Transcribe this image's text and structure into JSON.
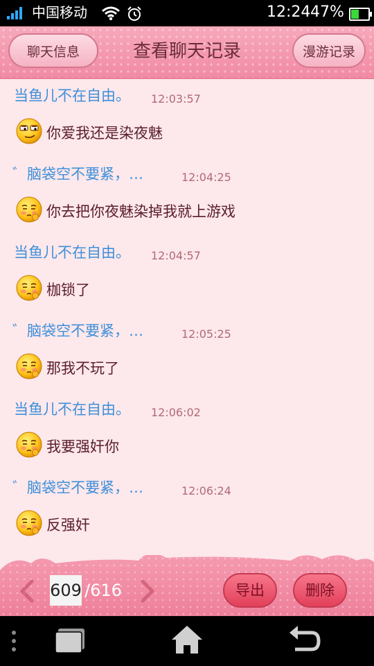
{
  "status_bar": {
    "carrier": "中国移动",
    "time": "12:24",
    "battery": "47%",
    "battery_level": 0.47
  },
  "header": {
    "left_button": "聊天信息",
    "title": "查看聊天记录",
    "right_button": "漫游记录"
  },
  "messages": [
    {
      "sender": "当鱼儿不在自由。",
      "time": "12:03:57",
      "text": "你爱我还是染夜魅",
      "emoji": "smug-face"
    },
    {
      "sender": "゛脑袋空不要紧，…",
      "time": "12:04:25",
      "text": "你去把你夜魅染掉我就上游戏",
      "emoji": "shy-face"
    },
    {
      "sender": "当鱼儿不在自由。",
      "time": "12:04:57",
      "text": "枷锁了",
      "emoji": "shy-face"
    },
    {
      "sender": "゛脑袋空不要紧，…",
      "time": "12:05:25",
      "text": " 那我不玩了",
      "emoji": "shy-face"
    },
    {
      "sender": "当鱼儿不在自由。",
      "time": "12:06:02",
      "text": "我要强奸你",
      "emoji": "shy-face"
    },
    {
      "sender": "゛脑袋空不要紧，…",
      "time": "12:06:24",
      "text": " 反强奸",
      "emoji": "shy-face"
    }
  ],
  "pagination": {
    "current": "609",
    "total": "/616"
  },
  "toolbar": {
    "export_label": "导出",
    "delete_label": "删除"
  },
  "colors": {
    "background": "#fde8ec",
    "header": "#f18aa4",
    "sender": "#3f8fd8",
    "time": "#b06a74",
    "message_text": "#5a1e2c",
    "action_button": "#e2405a"
  }
}
